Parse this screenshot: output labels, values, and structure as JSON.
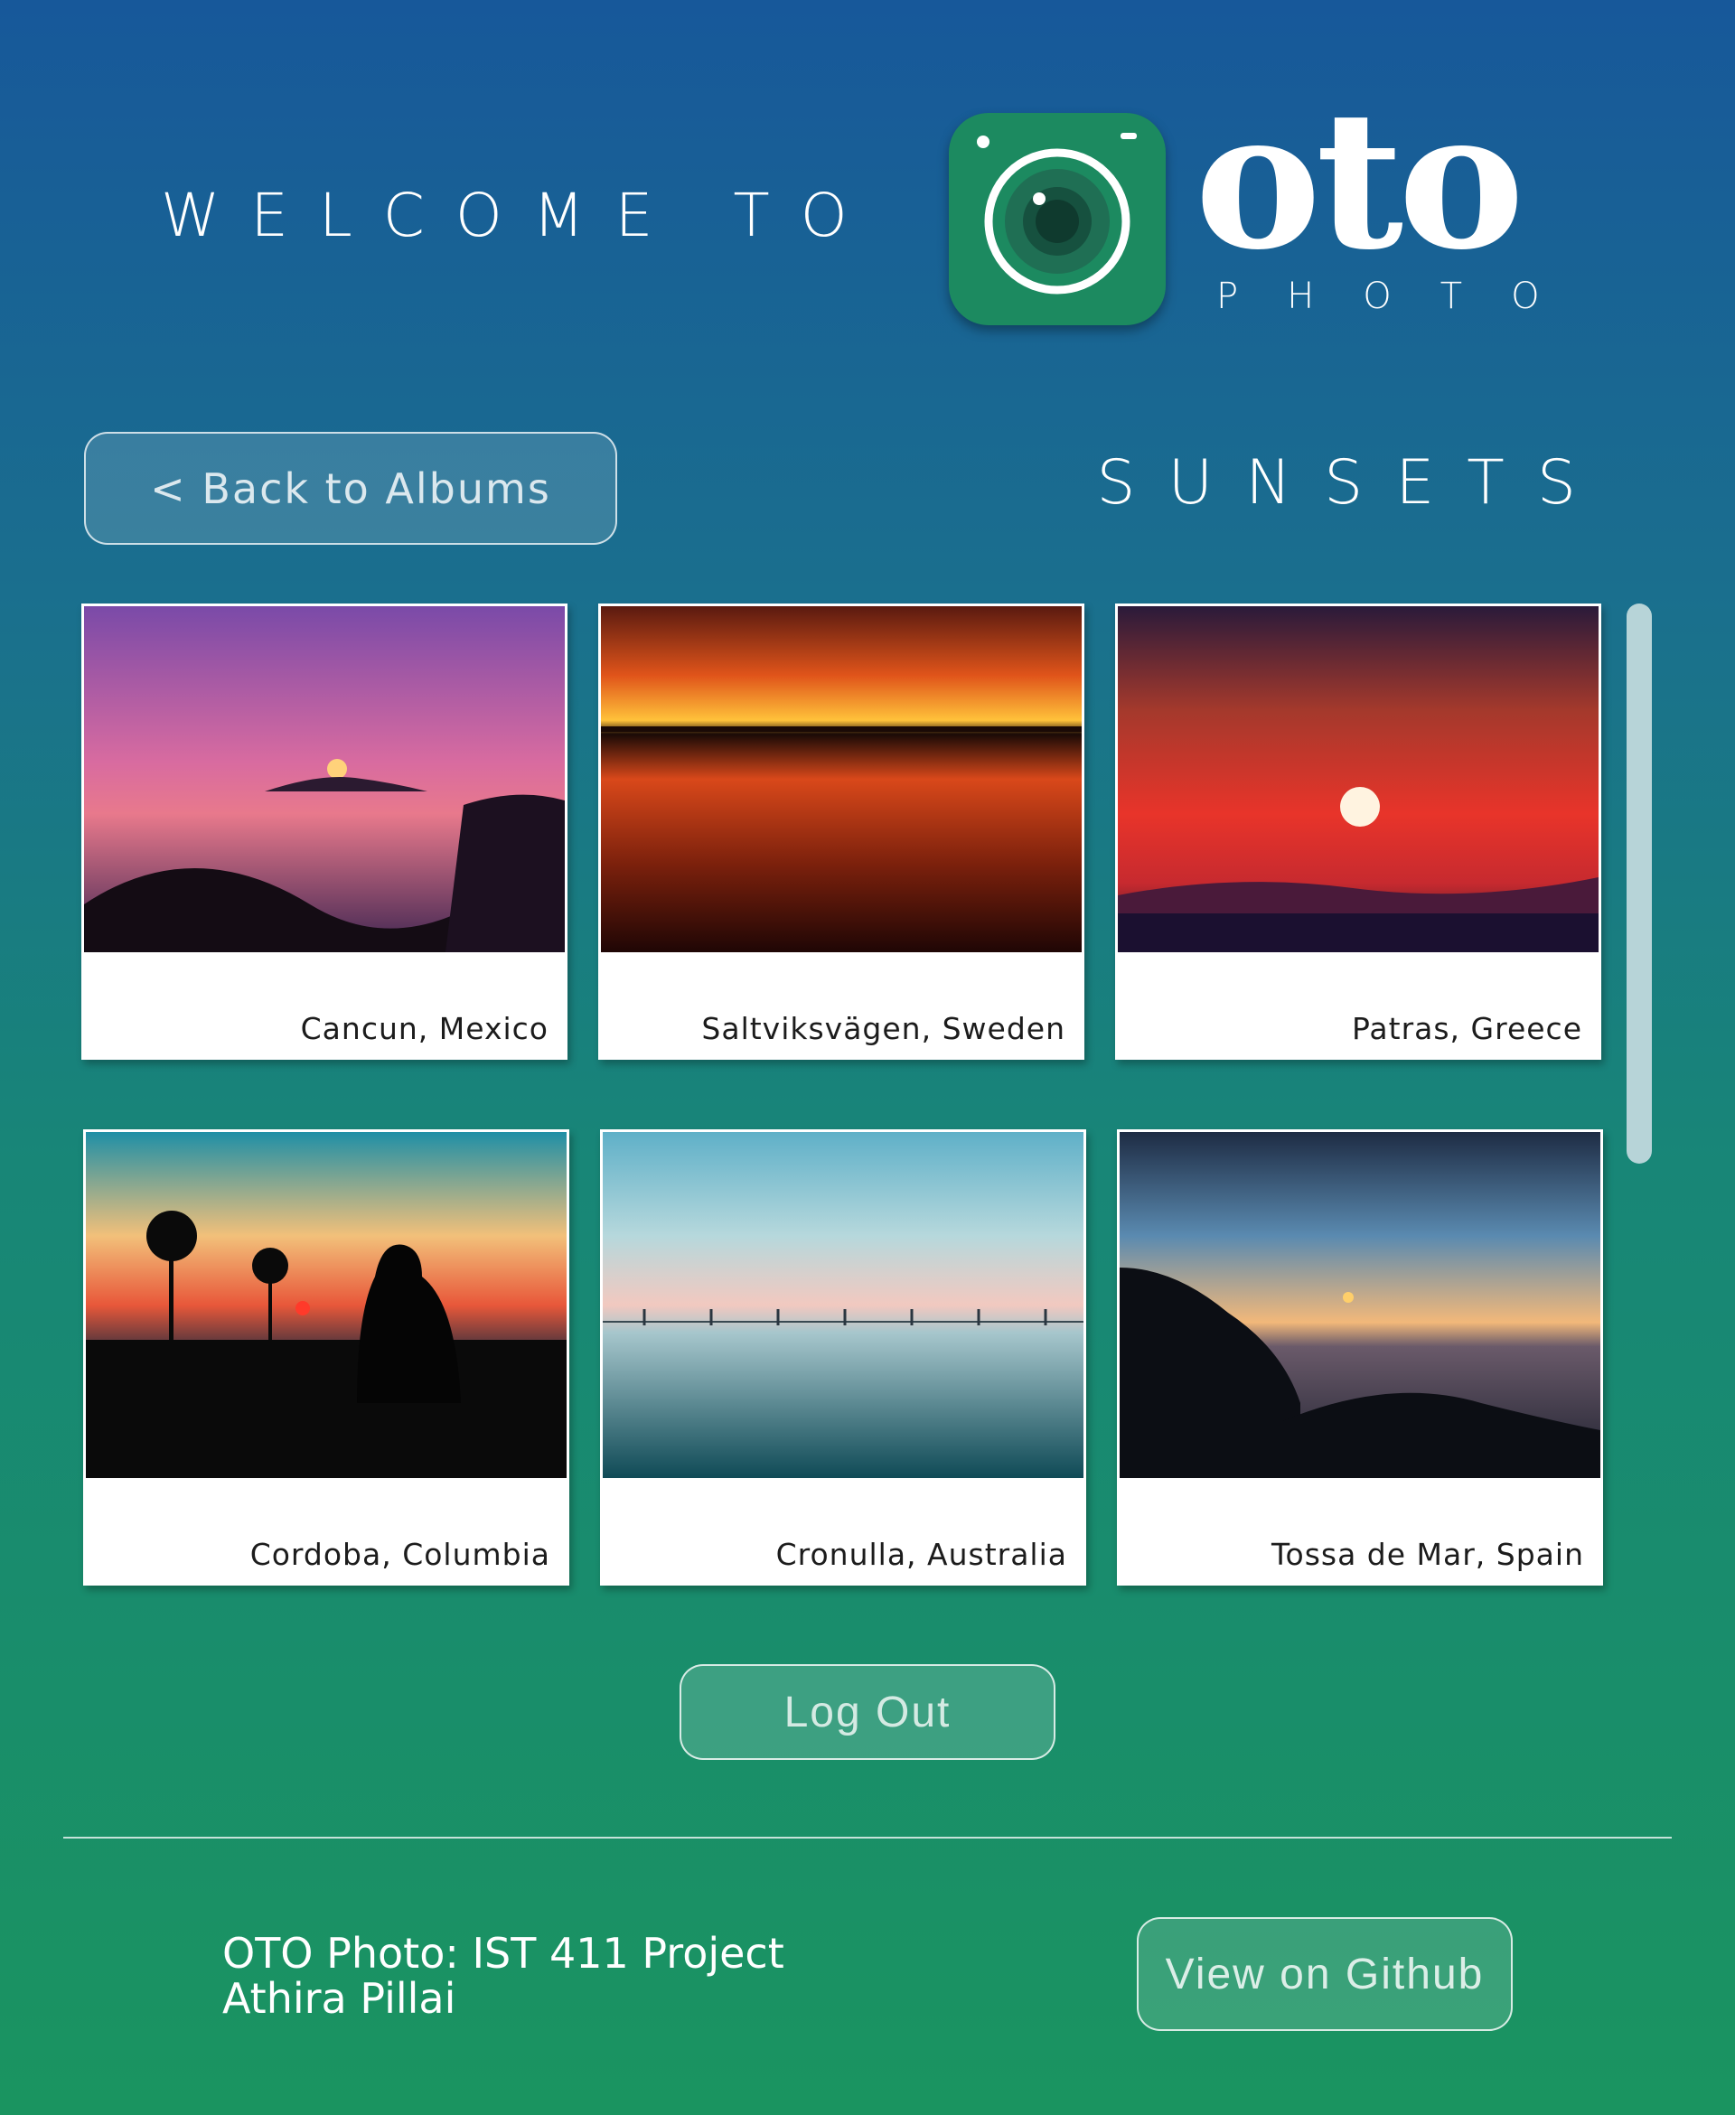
{
  "header": {
    "welcome": "WELCOME TO",
    "brand_name": "oto",
    "brand_sub": "PHOTO"
  },
  "album": {
    "back_label": "< Back to Albums",
    "title": "SUNSETS"
  },
  "gallery": [
    {
      "caption": "Cancun, Mexico",
      "image": "sunset-bay-purple"
    },
    {
      "caption": "Saltviksvägen, Sweden",
      "image": "sunset-orange-clouds-water"
    },
    {
      "caption": "Patras, Greece",
      "image": "sunset-red-sun"
    },
    {
      "caption": "Cordoba, Columbia",
      "image": "sunset-silhouette-palms"
    },
    {
      "caption": "Cronulla, Australia",
      "image": "sunset-calm-sea"
    },
    {
      "caption": "Tossa de Mar, Spain",
      "image": "sunset-coast-dusk"
    }
  ],
  "actions": {
    "logout_label": "Log Out"
  },
  "footer": {
    "project_line": "OTO Photo: IST 411 Project",
    "author": "Athira Pillai",
    "github_label": "View on Github"
  },
  "colors": {
    "gradient_top": "#17589a",
    "gradient_bottom": "#1a9460",
    "icon_green": "#1c8a60"
  }
}
